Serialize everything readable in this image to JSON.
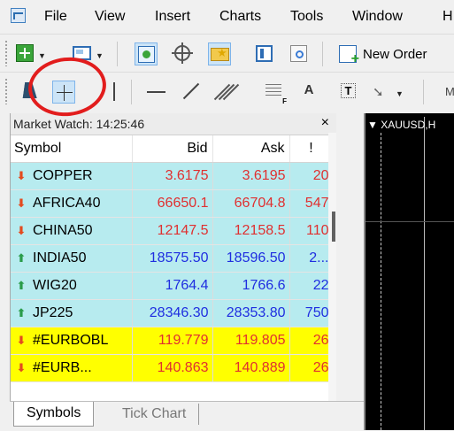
{
  "menu": {
    "items": [
      "File",
      "View",
      "Insert",
      "Charts",
      "Tools",
      "Window",
      "H"
    ]
  },
  "toolbar": {
    "new_order_label": "New Order",
    "text_tool": "A",
    "label_tool": "T",
    "truncated_label": "M"
  },
  "market_watch": {
    "title": "Market Watch: 14:25:46",
    "close": "×",
    "columns": {
      "symbol": "Symbol",
      "bid": "Bid",
      "ask": "Ask",
      "spread": "!"
    },
    "rows": [
      {
        "symbol": "COPPER",
        "direction": "down",
        "bid": "3.6175",
        "ask": "3.6195",
        "spread": "20",
        "bg": "#b7ebef",
        "color": "#e03030"
      },
      {
        "symbol": "AFRICA40",
        "direction": "down",
        "bid": "66650.1",
        "ask": "66704.8",
        "spread": "547",
        "bg": "#b7ebef",
        "color": "#e03030"
      },
      {
        "symbol": "CHINA50",
        "direction": "down",
        "bid": "12147.5",
        "ask": "12158.5",
        "spread": "110",
        "bg": "#b7ebef",
        "color": "#e03030"
      },
      {
        "symbol": "INDIA50",
        "direction": "up",
        "bid": "18575.50",
        "ask": "18596.50",
        "spread": "2...",
        "bg": "#b7ebef",
        "color": "#1f2ee0"
      },
      {
        "symbol": "WIG20",
        "direction": "up",
        "bid": "1764.4",
        "ask": "1766.6",
        "spread": "22",
        "bg": "#b7ebef",
        "color": "#1f2ee0"
      },
      {
        "symbol": "JP225",
        "direction": "up",
        "bid": "28346.30",
        "ask": "28353.80",
        "spread": "750",
        "bg": "#b7ebef",
        "color": "#1f2ee0"
      },
      {
        "symbol": "#EURBOBL",
        "direction": "down",
        "bid": "119.779",
        "ask": "119.805",
        "spread": "26",
        "bg": "#ffff00",
        "color": "#e03030"
      },
      {
        "symbol": "#EURB...",
        "direction": "down",
        "bid": "140.863",
        "ask": "140.889",
        "spread": "26",
        "bg": "#ffff00",
        "color": "#e03030"
      }
    ],
    "tabs": [
      "Symbols",
      "Tick Chart"
    ]
  },
  "chart": {
    "title": "XAUUSD,H"
  },
  "colors": {
    "down_arrow": "#e34b1f",
    "up_arrow": "#2a9c4a",
    "annotation": "#e21d1d"
  }
}
